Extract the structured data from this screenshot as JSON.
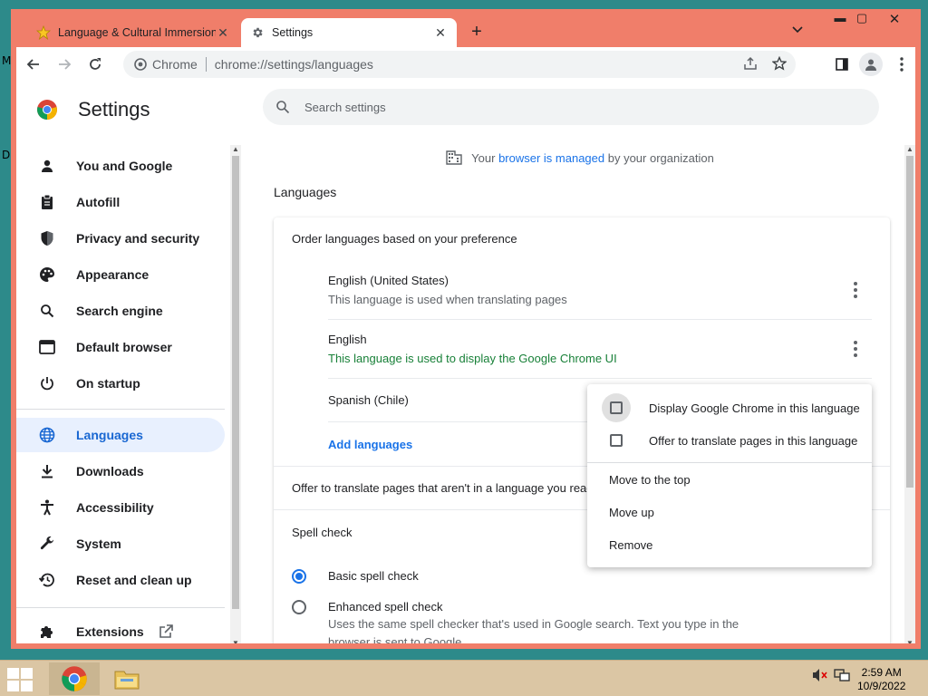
{
  "desktop": {
    "labels": [
      "M",
      "D"
    ]
  },
  "tabs": [
    {
      "title": "Language & Cultural Immersion",
      "favicon": "star-icon",
      "active": false
    },
    {
      "title": "Settings",
      "favicon": "gear-icon",
      "active": true
    }
  ],
  "newtab": "+",
  "window_controls": {
    "minimize": "▬",
    "maximize": "▢",
    "close": "✕"
  },
  "toolbar": {
    "chip_label": "Chrome",
    "url": "chrome://settings/languages"
  },
  "settings": {
    "title": "Settings",
    "search_placeholder": "Search settings"
  },
  "sidebar": {
    "items": [
      {
        "label": "You and Google",
        "icon": "person-icon"
      },
      {
        "label": "Autofill",
        "icon": "clipboard-icon"
      },
      {
        "label": "Privacy and security",
        "icon": "shield-icon"
      },
      {
        "label": "Appearance",
        "icon": "palette-icon"
      },
      {
        "label": "Search engine",
        "icon": "search-icon"
      },
      {
        "label": "Default browser",
        "icon": "browser-icon"
      },
      {
        "label": "On startup",
        "icon": "power-icon"
      },
      {
        "label": "Languages",
        "icon": "globe-icon",
        "active": true
      },
      {
        "label": "Downloads",
        "icon": "download-icon"
      },
      {
        "label": "Accessibility",
        "icon": "accessibility-icon"
      },
      {
        "label": "System",
        "icon": "wrench-icon"
      },
      {
        "label": "Reset and clean up",
        "icon": "history-icon"
      },
      {
        "label": "Extensions",
        "icon": "puzzle-icon"
      }
    ]
  },
  "main": {
    "managed_prefix": "Your ",
    "managed_link": "browser is managed",
    "managed_suffix": " by your organization",
    "section_title": "Languages",
    "order_label": "Order languages based on your preference",
    "languages": [
      {
        "name": "English (United States)",
        "desc": "This language is used when translating pages"
      },
      {
        "name": "English",
        "desc": "This language is used to display the Google Chrome UI"
      },
      {
        "name": "Spanish (Chile)",
        "desc": ""
      }
    ],
    "add_languages": "Add languages",
    "offer_translate": "Offer to translate pages that aren't in a language you read",
    "spell_check": {
      "title": "Spell check",
      "basic": "Basic spell check",
      "enhanced": "Enhanced spell check",
      "enhanced_desc": "Uses the same spell checker that's used in Google search. Text you type in the browser is sent to Google."
    }
  },
  "context_menu": {
    "display_chrome": "Display Google Chrome in this language",
    "offer_translate": "Offer to translate pages in this language",
    "move_top": "Move to the top",
    "move_up": "Move up",
    "remove": "Remove"
  },
  "taskbar": {
    "time": "2:59 AM",
    "date": "10/9/2022"
  }
}
